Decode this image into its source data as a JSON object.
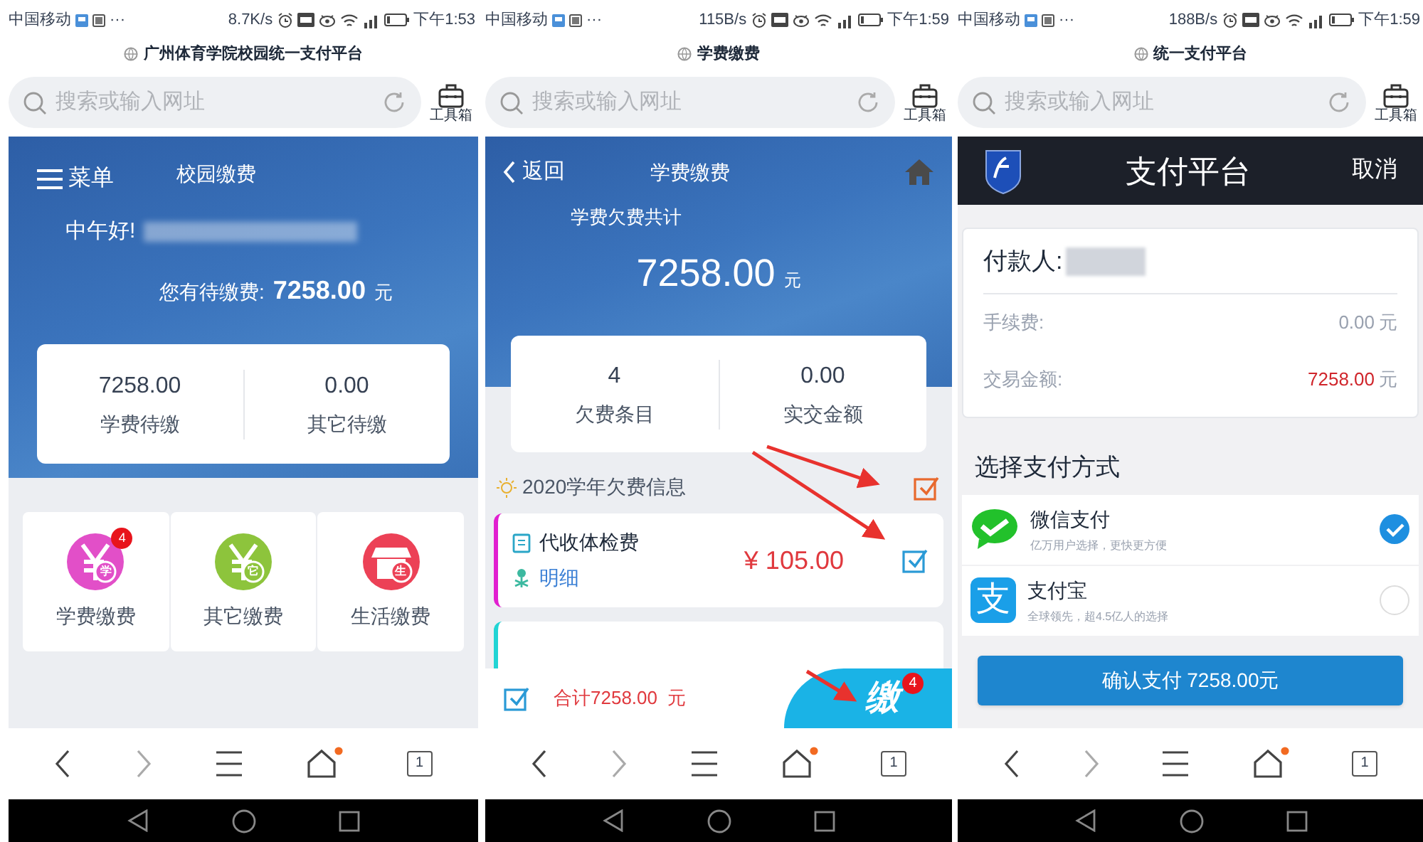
{
  "phones": [
    {
      "status_bar": {
        "carrier": "中国移动",
        "overflow": "···",
        "speed": "8.7K/s",
        "time": "下午1:53"
      },
      "page_title": "广州体育学院校园统一支付平台",
      "search": {
        "placeholder": "搜索或输入网址"
      },
      "toolbox_label": "工具箱",
      "screen": {
        "kind": "campus_home",
        "menu_label": "菜单",
        "title": "校园缴费",
        "greeting": "中午好!",
        "due_label": "您有待缴费:",
        "due_amount": "7258.00",
        "due_unit": "元",
        "stats": [
          {
            "value": "7258.00",
            "label": "学费待缴"
          },
          {
            "value": "0.00",
            "label": "其它待缴"
          }
        ],
        "tiles": [
          {
            "kind": "yuan",
            "label": "学费缴费",
            "color": "#e24fc8",
            "icon_text": "学",
            "badge": "4"
          },
          {
            "kind": "yuan",
            "label": "其它缴费",
            "color": "#8dc43c",
            "icon_text": "它"
          },
          {
            "kind": "shop",
            "label": "生活缴费",
            "color": "#ec4156",
            "icon_text": "生"
          }
        ]
      },
      "nav": {
        "tab_count": "1"
      }
    },
    {
      "status_bar": {
        "carrier": "中国移动",
        "overflow": "···",
        "speed": "115B/s",
        "time": "下午1:59"
      },
      "page_title": "学费缴费",
      "search": {
        "placeholder": "搜索或输入网址"
      },
      "toolbox_label": "工具箱",
      "screen": {
        "kind": "tuition",
        "back_label": "返回",
        "title": "学费缴费",
        "total_label": "学费欠费共计",
        "total_amount": "7258.00",
        "total_unit": "元",
        "stats": [
          {
            "value": "4",
            "label": "欠费条目"
          },
          {
            "value": "0.00",
            "label": "实交金额"
          }
        ],
        "section": {
          "title": "2020学年欠费信息",
          "checked": true
        },
        "items": [
          {
            "name": "代收体检费",
            "link": "明细",
            "amount": "¥ 105.00",
            "checked": true,
            "color": "#e11fd0"
          },
          {
            "color": "#21d4d4"
          }
        ],
        "footer": {
          "checked": true,
          "total": "合计7258.00  元",
          "icon_text": "缴",
          "badge": "4"
        }
      },
      "nav": {
        "tab_count": "1"
      }
    },
    {
      "status_bar": {
        "carrier": "中国移动",
        "overflow": "···",
        "speed": "188B/s",
        "time": "下午1:59"
      },
      "page_title": "统一支付平台",
      "search": {
        "placeholder": "搜索或输入网址"
      },
      "toolbox_label": "工具箱",
      "screen": {
        "kind": "payment",
        "title": "支付平台",
        "cancel": "取消",
        "payer_label": "付款人:",
        "rows": [
          {
            "kind": "plain",
            "label": "手续费:",
            "value": "0.00",
            "unit": "元"
          },
          {
            "kind": "highlight",
            "label": "交易金额:",
            "value": "7258.00",
            "unit": "元"
          }
        ],
        "methods_title": "选择支付方式",
        "methods": [
          {
            "kind": "wechat",
            "name": "微信支付",
            "desc": "亿万用户选择，更快更方便",
            "selected": true
          },
          {
            "kind": "alipay",
            "name": "支付宝",
            "desc": "全球领先，超4.5亿人的选择",
            "icon_text": "支",
            "selected": false
          }
        ],
        "confirm": "确认支付 7258.00元"
      },
      "nav": {
        "tab_count": "1"
      }
    }
  ]
}
